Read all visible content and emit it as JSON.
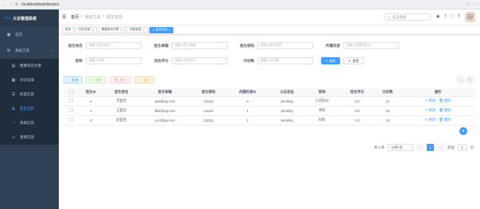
{
  "browser": {
    "url": "localhost/tool/doctors"
  },
  "app": {
    "title": "义诊管理系统"
  },
  "sidebar": {
    "items": [
      {
        "icon": "home-icon",
        "glyph": "▣",
        "label": "首页"
      },
      {
        "icon": "tool-icon",
        "glyph": "⚙",
        "label": "系统工具"
      }
    ],
    "subitems": [
      {
        "icon": "doc-icon",
        "glyph": "▤",
        "label": "健康资讯文章"
      },
      {
        "icon": "calendar-icon",
        "glyph": "▦",
        "label": "问诊记录"
      },
      {
        "icon": "list-icon",
        "glyph": "☰",
        "label": "科室信息"
      },
      {
        "icon": "doctor-icon",
        "glyph": "♟",
        "label": "医生信息"
      },
      {
        "icon": "chart-icon",
        "glyph": "◔",
        "label": "系统信息"
      },
      {
        "icon": "user-icon",
        "glyph": "☺",
        "label": "患者信息"
      }
    ]
  },
  "navbar": {
    "breadcrumb": [
      "首页",
      "系统工具",
      "医生信息"
    ],
    "search_placeholder": "点击搜索"
  },
  "tags": [
    "首页",
    "问诊记录",
    "健康资讯文章",
    "科室信息",
    "医生信息"
  ],
  "form": {
    "fields": [
      {
        "label": "医生姓名",
        "placeholder": "请输入医生姓名"
      },
      {
        "label": "医生邮箱",
        "placeholder": "请输入医生邮箱"
      },
      {
        "label": "医生密码",
        "placeholder": "请输入医生密码"
      },
      {
        "label": "所属科室",
        "placeholder": "请输入所属科室ID"
      },
      {
        "label": "职称",
        "placeholder": "请输入职称"
      },
      {
        "label": "综合评分",
        "placeholder": "请输入综合评分"
      },
      {
        "label": "问诊数",
        "placeholder": "请输入问诊数"
      }
    ],
    "search_btn": "搜索",
    "reset_btn": "重置"
  },
  "toolbar": {
    "add": "新增",
    "edit": "修改",
    "delete": "删除",
    "export": "导出"
  },
  "table": {
    "headers": [
      "医生ID",
      "医生姓名",
      "医生邮箱",
      "医生密码",
      "所属科室ID",
      "认证状态",
      "职称",
      "综合评分",
      "问诊数",
      "操作"
    ],
    "rows": [
      [
        "1",
        "李医生",
        "aaa@qq.com",
        "111111",
        "2",
        "pending",
        "心内科11",
        "5.0",
        "11"
      ],
      [
        "2",
        "王医生",
        "bbb@qq.com",
        "111111",
        "1",
        "pending",
        "骨科",
        "3.6",
        "22"
      ],
      [
        "3",
        "赵医生",
        "ccc@qq.com",
        "111111",
        "1",
        "pending",
        "妇科",
        "4.3",
        "41"
      ]
    ],
    "op_edit": "修改",
    "op_delete": "删除"
  },
  "pager": {
    "total": "共 3 条",
    "size": "10条/页",
    "page": "1",
    "goto_label": "前往",
    "goto_value": "1",
    "page_suffix": "页"
  }
}
